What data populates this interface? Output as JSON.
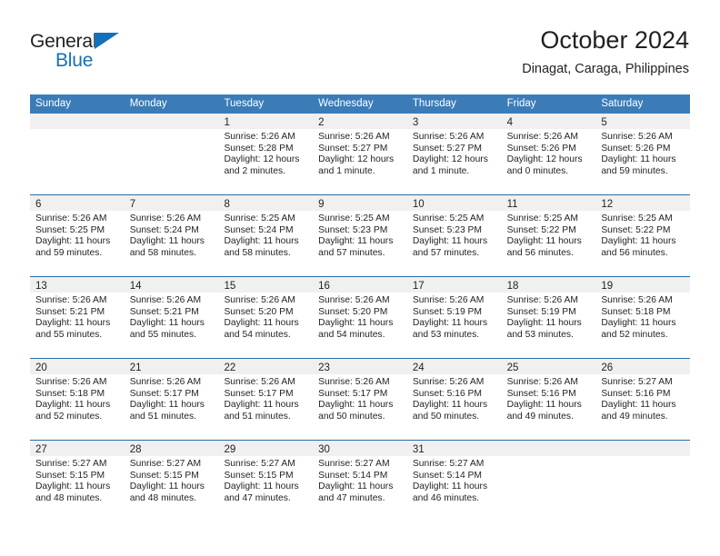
{
  "brand": {
    "name_top": "General",
    "name_bottom": "Blue",
    "accent_color": "#1271bb"
  },
  "header": {
    "title": "October 2024",
    "subtitle": "Dinagat, Caraga, Philippines"
  },
  "theme": {
    "header_bg": "#3b7cb8",
    "row_border": "#2b6ca8",
    "day_band_bg": "#f0f0f0",
    "text": "#231f20"
  },
  "weekdays": [
    "Sunday",
    "Monday",
    "Tuesday",
    "Wednesday",
    "Thursday",
    "Friday",
    "Saturday"
  ],
  "weeks": [
    [
      {
        "day": "",
        "empty": true
      },
      {
        "day": "",
        "empty": true
      },
      {
        "day": "1",
        "sunrise": "Sunrise: 5:26 AM",
        "sunset": "Sunset: 5:28 PM",
        "daylight": "Daylight: 12 hours and 2 minutes."
      },
      {
        "day": "2",
        "sunrise": "Sunrise: 5:26 AM",
        "sunset": "Sunset: 5:27 PM",
        "daylight": "Daylight: 12 hours and 1 minute."
      },
      {
        "day": "3",
        "sunrise": "Sunrise: 5:26 AM",
        "sunset": "Sunset: 5:27 PM",
        "daylight": "Daylight: 12 hours and 1 minute."
      },
      {
        "day": "4",
        "sunrise": "Sunrise: 5:26 AM",
        "sunset": "Sunset: 5:26 PM",
        "daylight": "Daylight: 12 hours and 0 minutes."
      },
      {
        "day": "5",
        "sunrise": "Sunrise: 5:26 AM",
        "sunset": "Sunset: 5:26 PM",
        "daylight": "Daylight: 11 hours and 59 minutes."
      }
    ],
    [
      {
        "day": "6",
        "sunrise": "Sunrise: 5:26 AM",
        "sunset": "Sunset: 5:25 PM",
        "daylight": "Daylight: 11 hours and 59 minutes."
      },
      {
        "day": "7",
        "sunrise": "Sunrise: 5:26 AM",
        "sunset": "Sunset: 5:24 PM",
        "daylight": "Daylight: 11 hours and 58 minutes."
      },
      {
        "day": "8",
        "sunrise": "Sunrise: 5:25 AM",
        "sunset": "Sunset: 5:24 PM",
        "daylight": "Daylight: 11 hours and 58 minutes."
      },
      {
        "day": "9",
        "sunrise": "Sunrise: 5:25 AM",
        "sunset": "Sunset: 5:23 PM",
        "daylight": "Daylight: 11 hours and 57 minutes."
      },
      {
        "day": "10",
        "sunrise": "Sunrise: 5:25 AM",
        "sunset": "Sunset: 5:23 PM",
        "daylight": "Daylight: 11 hours and 57 minutes."
      },
      {
        "day": "11",
        "sunrise": "Sunrise: 5:25 AM",
        "sunset": "Sunset: 5:22 PM",
        "daylight": "Daylight: 11 hours and 56 minutes."
      },
      {
        "day": "12",
        "sunrise": "Sunrise: 5:25 AM",
        "sunset": "Sunset: 5:22 PM",
        "daylight": "Daylight: 11 hours and 56 minutes."
      }
    ],
    [
      {
        "day": "13",
        "sunrise": "Sunrise: 5:26 AM",
        "sunset": "Sunset: 5:21 PM",
        "daylight": "Daylight: 11 hours and 55 minutes."
      },
      {
        "day": "14",
        "sunrise": "Sunrise: 5:26 AM",
        "sunset": "Sunset: 5:21 PM",
        "daylight": "Daylight: 11 hours and 55 minutes."
      },
      {
        "day": "15",
        "sunrise": "Sunrise: 5:26 AM",
        "sunset": "Sunset: 5:20 PM",
        "daylight": "Daylight: 11 hours and 54 minutes."
      },
      {
        "day": "16",
        "sunrise": "Sunrise: 5:26 AM",
        "sunset": "Sunset: 5:20 PM",
        "daylight": "Daylight: 11 hours and 54 minutes."
      },
      {
        "day": "17",
        "sunrise": "Sunrise: 5:26 AM",
        "sunset": "Sunset: 5:19 PM",
        "daylight": "Daylight: 11 hours and 53 minutes."
      },
      {
        "day": "18",
        "sunrise": "Sunrise: 5:26 AM",
        "sunset": "Sunset: 5:19 PM",
        "daylight": "Daylight: 11 hours and 53 minutes."
      },
      {
        "day": "19",
        "sunrise": "Sunrise: 5:26 AM",
        "sunset": "Sunset: 5:18 PM",
        "daylight": "Daylight: 11 hours and 52 minutes."
      }
    ],
    [
      {
        "day": "20",
        "sunrise": "Sunrise: 5:26 AM",
        "sunset": "Sunset: 5:18 PM",
        "daylight": "Daylight: 11 hours and 52 minutes."
      },
      {
        "day": "21",
        "sunrise": "Sunrise: 5:26 AM",
        "sunset": "Sunset: 5:17 PM",
        "daylight": "Daylight: 11 hours and 51 minutes."
      },
      {
        "day": "22",
        "sunrise": "Sunrise: 5:26 AM",
        "sunset": "Sunset: 5:17 PM",
        "daylight": "Daylight: 11 hours and 51 minutes."
      },
      {
        "day": "23",
        "sunrise": "Sunrise: 5:26 AM",
        "sunset": "Sunset: 5:17 PM",
        "daylight": "Daylight: 11 hours and 50 minutes."
      },
      {
        "day": "24",
        "sunrise": "Sunrise: 5:26 AM",
        "sunset": "Sunset: 5:16 PM",
        "daylight": "Daylight: 11 hours and 50 minutes."
      },
      {
        "day": "25",
        "sunrise": "Sunrise: 5:26 AM",
        "sunset": "Sunset: 5:16 PM",
        "daylight": "Daylight: 11 hours and 49 minutes."
      },
      {
        "day": "26",
        "sunrise": "Sunrise: 5:27 AM",
        "sunset": "Sunset: 5:16 PM",
        "daylight": "Daylight: 11 hours and 49 minutes."
      }
    ],
    [
      {
        "day": "27",
        "sunrise": "Sunrise: 5:27 AM",
        "sunset": "Sunset: 5:15 PM",
        "daylight": "Daylight: 11 hours and 48 minutes."
      },
      {
        "day": "28",
        "sunrise": "Sunrise: 5:27 AM",
        "sunset": "Sunset: 5:15 PM",
        "daylight": "Daylight: 11 hours and 48 minutes."
      },
      {
        "day": "29",
        "sunrise": "Sunrise: 5:27 AM",
        "sunset": "Sunset: 5:15 PM",
        "daylight": "Daylight: 11 hours and 47 minutes."
      },
      {
        "day": "30",
        "sunrise": "Sunrise: 5:27 AM",
        "sunset": "Sunset: 5:14 PM",
        "daylight": "Daylight: 11 hours and 47 minutes."
      },
      {
        "day": "31",
        "sunrise": "Sunrise: 5:27 AM",
        "sunset": "Sunset: 5:14 PM",
        "daylight": "Daylight: 11 hours and 46 minutes."
      },
      {
        "day": "",
        "empty": true
      },
      {
        "day": "",
        "empty": true
      }
    ]
  ]
}
